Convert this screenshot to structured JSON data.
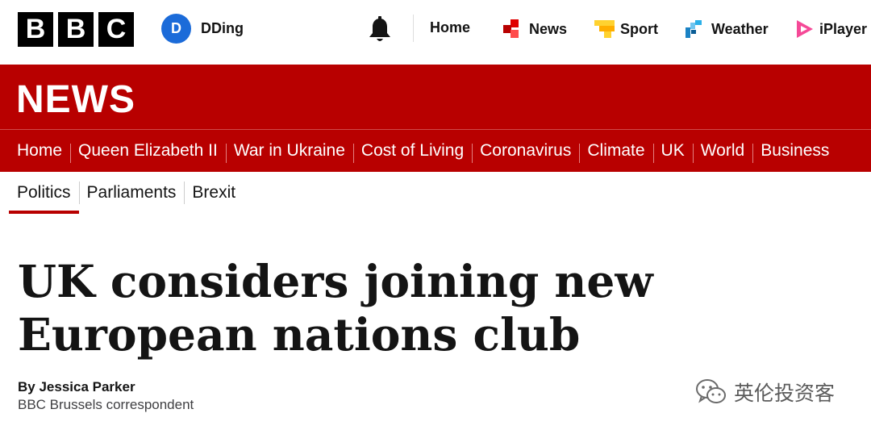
{
  "topbar": {
    "logo_letters": [
      "B",
      "B",
      "C"
    ],
    "account": {
      "initial": "D",
      "name": "DDing"
    },
    "nav": [
      {
        "label": "Home",
        "icon": "none"
      },
      {
        "label": "News",
        "icon": "news-icon",
        "color": "#e00000"
      },
      {
        "label": "Sport",
        "icon": "sport-icon",
        "color": "#ffd230"
      },
      {
        "label": "Weather",
        "icon": "weather-icon",
        "color": "#1a82c4"
      },
      {
        "label": "iPlayer",
        "icon": "iplayer-icon",
        "color": "#f54997"
      }
    ]
  },
  "header": {
    "title": "NEWS",
    "color": "#b80000",
    "nav": [
      "Home",
      "Queen Elizabeth II",
      "War in Ukraine",
      "Cost of Living",
      "Coronavirus",
      "Climate",
      "UK",
      "World",
      "Business"
    ]
  },
  "subnav": {
    "items": [
      "Politics",
      "Parliaments",
      "Brexit"
    ],
    "active": "Politics"
  },
  "article": {
    "headline": "UK considers joining new European nations club",
    "author": "By Jessica Parker",
    "role": "BBC Brussels correspondent"
  },
  "watermark": {
    "text": "英伦投资客",
    "icon": "wechat-icon"
  }
}
